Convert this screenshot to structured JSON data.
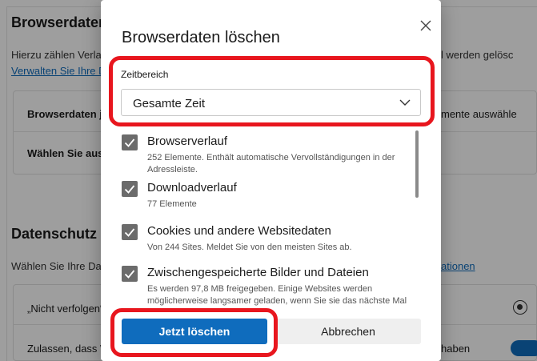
{
  "background": {
    "section1_title": "Browserdaten löschen",
    "section1_desc_left": "Hierzu zählen Verlauf, Kennwörter, Cookies und mehr. Nur Daten aus diesem Profil werden gelöscht.",
    "section1_desc_right": "l werden gelösc",
    "manage_link": "Verwalten Sie Ihre Daten",
    "row1_label": "Browserdaten jetzt löschen",
    "row1_right": "mente auswähle",
    "row2_label": "Wählen Sie aus, was beim Schließen des Browsers gelöscht werden soll",
    "section2_title": "Datenschutz",
    "section2_desc_left": "Wählen Sie Ihre Datenschutzeinstellungen",
    "section2_link_right": "ationen",
    "row3_label": "„Nicht verfolgen“-Anforderungen senden",
    "row4_label": "Zulassen, dass Websites überprüfen, ob Sie Zahlungsmethoden gespeichert haben",
    "row4_right": "haben"
  },
  "dialog": {
    "title": "Browserdaten löschen",
    "close_icon": "close-icon",
    "time_range_label": "Zeitbereich",
    "time_range_value": "Gesamte Zeit",
    "items": [
      {
        "label": "Browserverlauf",
        "desc": "252 Elemente. Enthält automatische Vervollständigungen in der Adressleiste.",
        "checked": true
      },
      {
        "label": "Downloadverlauf",
        "desc": "77 Elemente",
        "checked": true
      },
      {
        "label": "Cookies und andere Websitedaten",
        "desc": "Von 244 Sites. Meldet Sie von den meisten Sites ab.",
        "checked": true
      },
      {
        "label": "Zwischengespeicherte Bilder und Dateien",
        "desc": "Es werden 97,8 MB freigegeben. Einige Websites werden möglicherweise langsamer geladen, wenn Sie sie das nächste Mal besuchen.",
        "checked": true
      }
    ],
    "primary_button": "Jetzt löschen",
    "secondary_button": "Abbrechen"
  },
  "colors": {
    "accent": "#0f6cbd",
    "highlight": "#e8161e",
    "checkbox": "#6b6b6b"
  }
}
